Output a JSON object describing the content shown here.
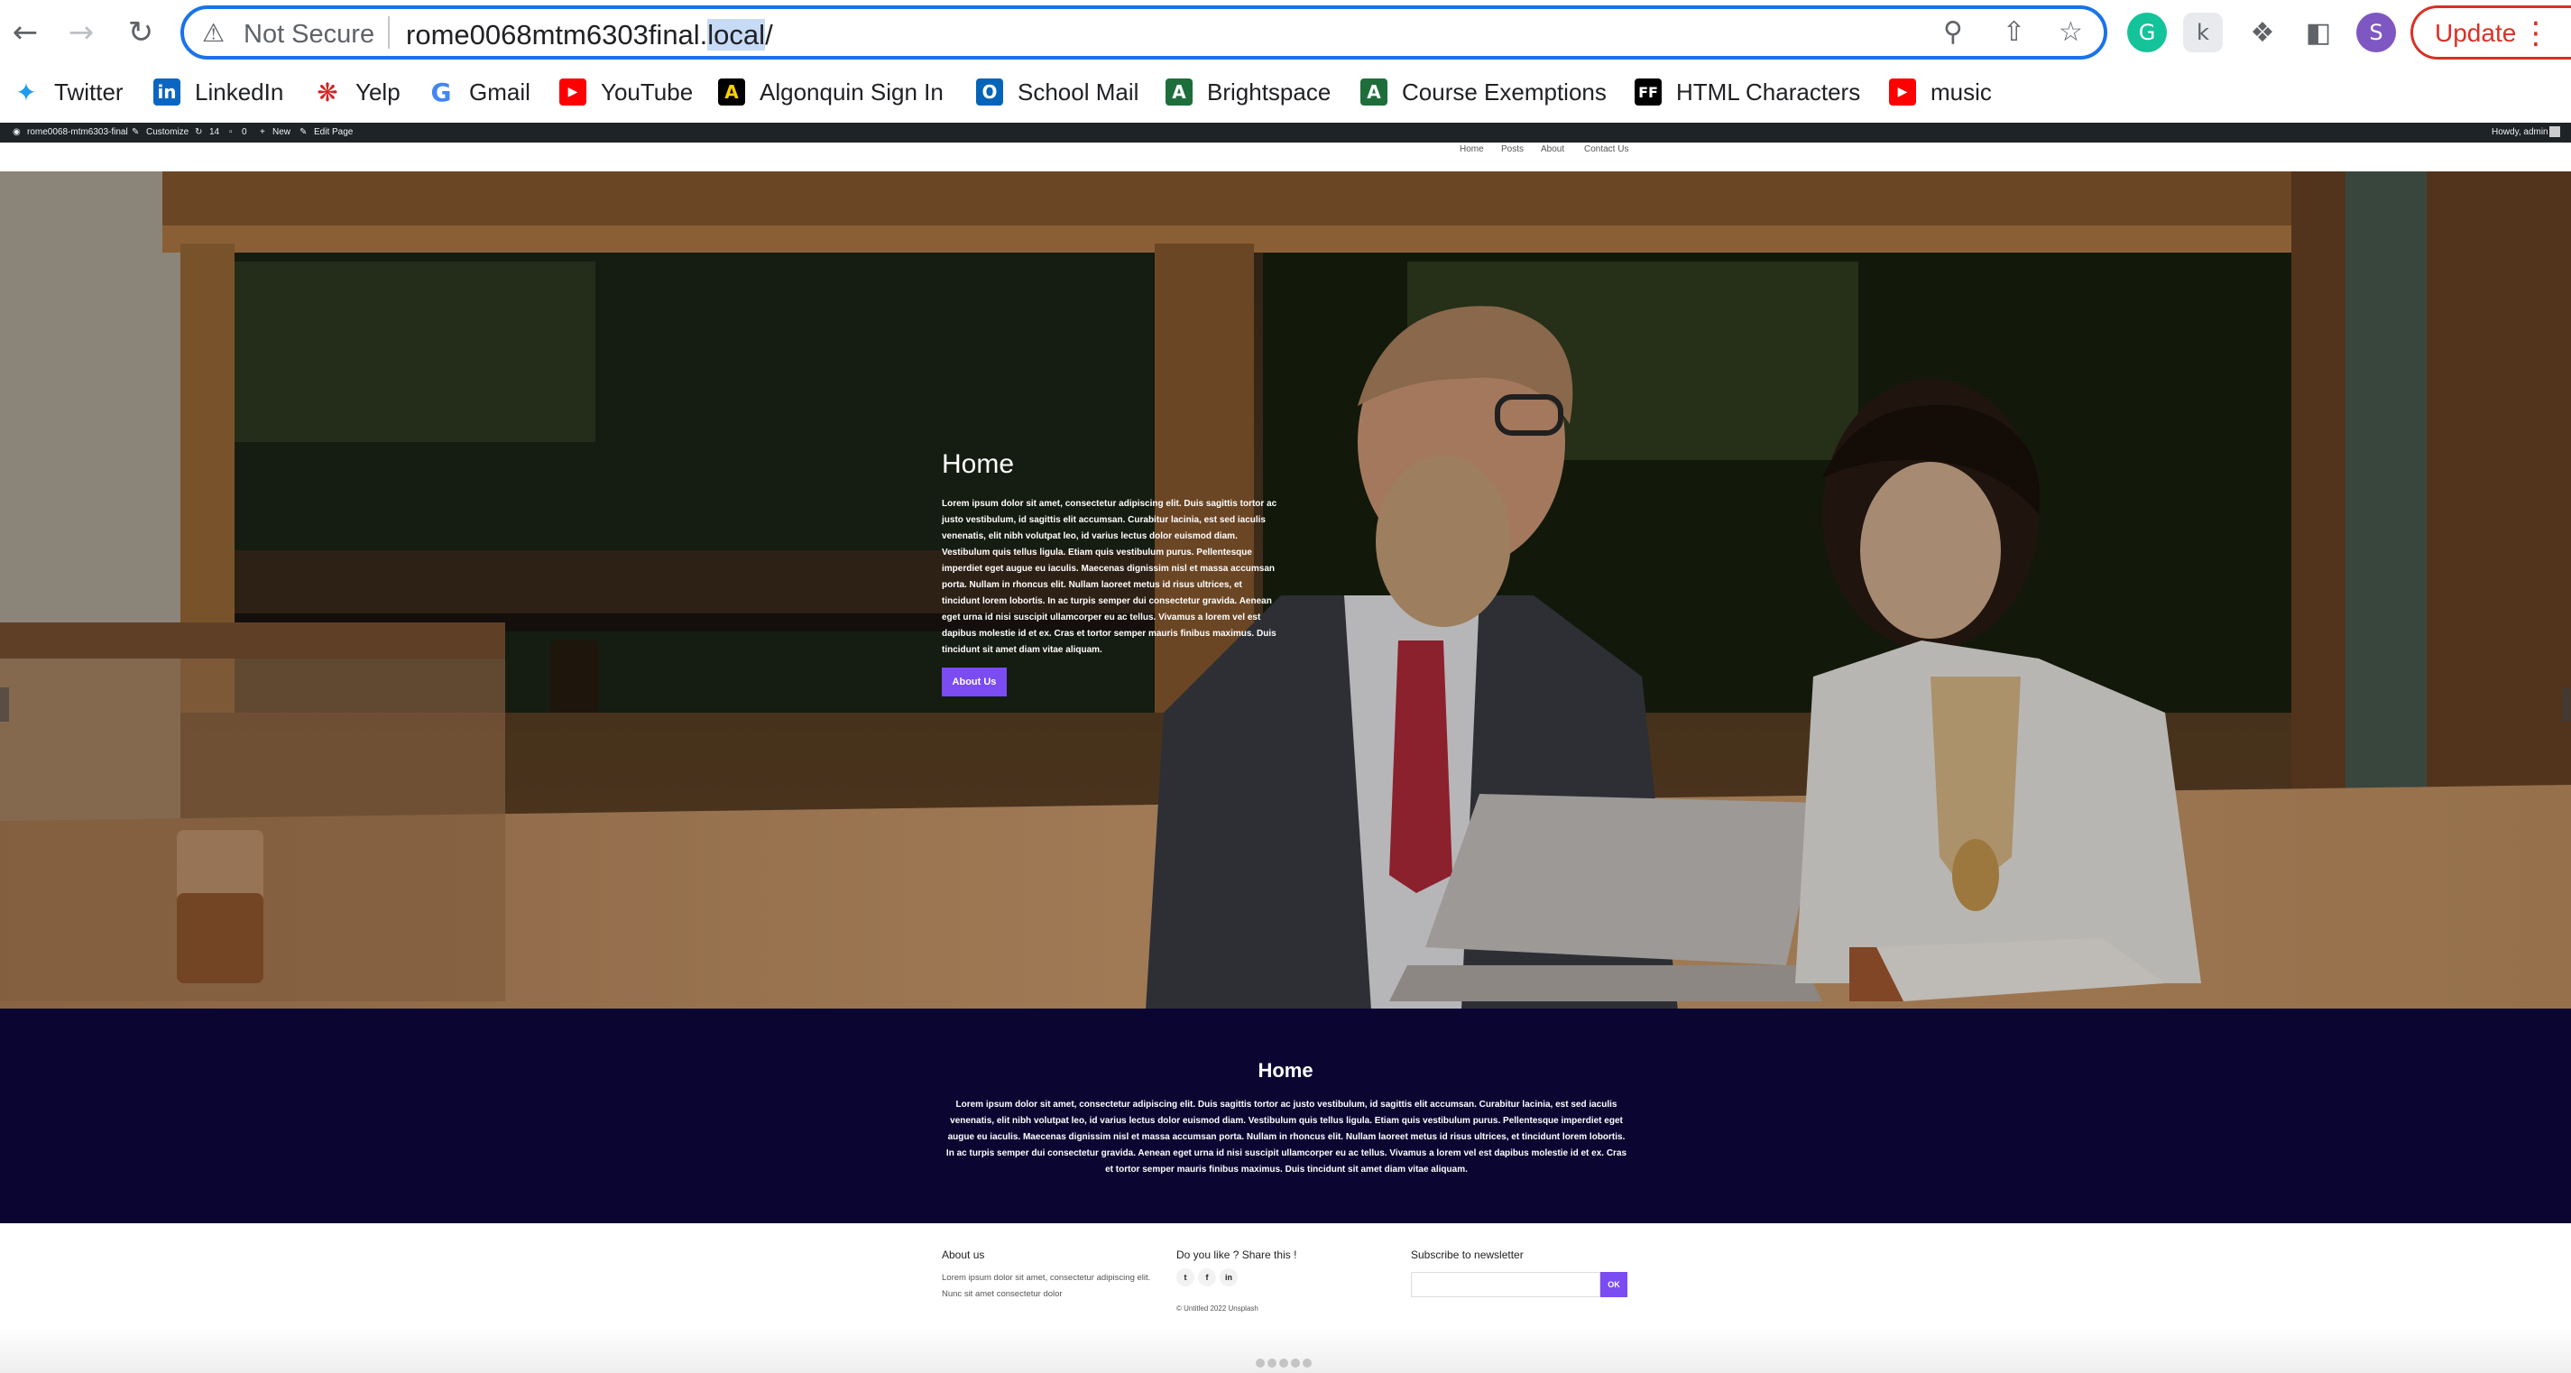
{
  "browser": {
    "security_label": "Not Secure",
    "url_main": "rome0068mtm6303final.",
    "url_highlight": "local",
    "url_tail": "/",
    "update_label": "Update",
    "profile_initial": "S"
  },
  "bookmarks": [
    {
      "label": "Twitter",
      "icon": "twitter-icon"
    },
    {
      "label": "LinkedIn",
      "icon": "linkedin-icon"
    },
    {
      "label": "Yelp",
      "icon": "yelp-icon"
    },
    {
      "label": "Gmail",
      "icon": "google-icon"
    },
    {
      "label": "YouTube",
      "icon": "youtube-icon"
    },
    {
      "label": "Algonquin Sign In",
      "icon": "algonquin-icon"
    },
    {
      "label": "School Mail",
      "icon": "outlook-icon"
    },
    {
      "label": "Brightspace",
      "icon": "brightspace-icon"
    },
    {
      "label": "Course Exemptions",
      "icon": "brightspace-icon"
    },
    {
      "label": "HTML Characters",
      "icon": "ff-icon"
    },
    {
      "label": "music",
      "icon": "youtube-icon"
    }
  ],
  "admin_bar": {
    "site_name": "rome0068-mtm6303-final",
    "customize": "Customize",
    "updates_count": "14",
    "comments_count": "0",
    "new_label": "New",
    "edit_label": "Edit Page",
    "howdy": "Howdy, admin"
  },
  "site_nav": [
    "Home",
    "Posts",
    "About",
    "Contact Us"
  ],
  "hero": {
    "title": "Home",
    "text": "Lorem ipsum dolor sit amet, consectetur adipiscing elit. Duis sagittis tortor ac justo vestibulum, id sagittis elit accumsan. Curabitur lacinia, est sed iaculis venenatis, elit nibh volutpat leo, id varius lectus dolor euismod diam. Vestibulum quis tellus ligula. Etiam quis vestibulum purus. Pellentesque imperdiet eget augue eu iaculis. Maecenas dignissim nisl et massa accumsan porta. Nullam in rhoncus elit. Nullam laoreet metus id risus ultrices, et tincidunt lorem lobortis. In ac turpis semper dui consectetur gravida. Aenean eget urna id nisi suscipit ullamcorper eu ac tellus. Vivamus a lorem vel est dapibus molestie id et ex. Cras et tortor semper mauris finibus maximus. Duis tincidunt sit amet diam vitae aliquam.",
    "button": "About Us"
  },
  "section": {
    "title": "Home",
    "text": "Lorem ipsum dolor sit amet, consectetur adipiscing elit. Duis sagittis tortor ac justo vestibulum, id sagittis elit accumsan. Curabitur lacinia, est sed iaculis venenatis, elit nibh volutpat leo, id varius lectus dolor euismod diam. Vestibulum quis tellus ligula. Etiam quis vestibulum purus. Pellentesque imperdiet eget augue eu iaculis. Maecenas dignissim nisl et massa accumsan porta. Nullam in rhoncus elit. Nullam laoreet metus id risus ultrices, et tincidunt lorem lobortis. In ac turpis semper dui consectetur gravida. Aenean eget urna id nisi suscipit ullamcorper eu ac tellus. Vivamus a lorem vel est dapibus molestie id et ex. Cras et tortor semper mauris finibus maximus. Duis tincidunt sit amet diam vitae aliquam."
  },
  "footer": {
    "about_title": "About us",
    "about_text": "Lorem ipsum dolor sit amet, consectetur adipiscing elit. Nunc sit amet consectetur dolor",
    "share_title": "Do you like ? Share this !",
    "social": [
      "t",
      "f",
      "in"
    ],
    "copyright": "© Untitled 2022 Unsplash",
    "newsletter_title": "Subscribe to newsletter",
    "newsletter_button": "OK"
  },
  "colors": {
    "accent": "#7a4cf2",
    "dark_section": "#0a0631",
    "admin_bar": "#1d2327",
    "omnibox_focus": "#1a73e8",
    "update": "#d93025"
  }
}
